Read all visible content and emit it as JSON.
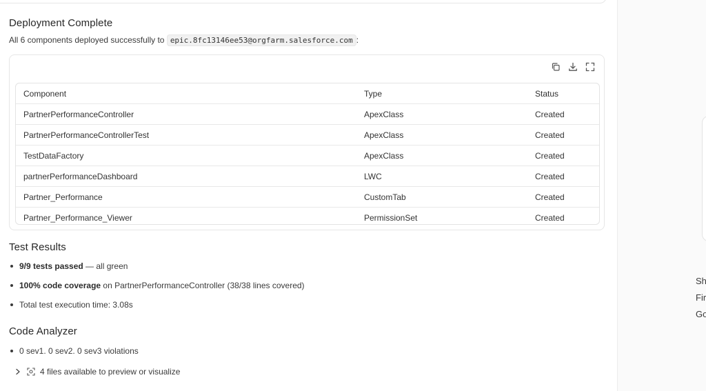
{
  "deployment": {
    "title": "Deployment Complete",
    "summary_prefix": "All 6 components deployed successfully to",
    "org": "epic.8fc13146ee53@orgfarm.salesforce.com",
    "summary_suffix": ":",
    "tools": [
      "copy-icon",
      "download-icon",
      "expand-icon"
    ],
    "table": {
      "headers": [
        "Component",
        "Type",
        "Status"
      ],
      "rows": [
        [
          "PartnerPerformanceController",
          "ApexClass",
          "Created"
        ],
        [
          "PartnerPerformanceControllerTest",
          "ApexClass",
          "Created"
        ],
        [
          "TestDataFactory",
          "ApexClass",
          "Created"
        ],
        [
          "partnerPerformanceDashboard",
          "LWC",
          "Created"
        ],
        [
          "Partner_Performance",
          "CustomTab",
          "Created"
        ],
        [
          "Partner_Performance_Viewer",
          "PermissionSet",
          "Created"
        ]
      ]
    }
  },
  "tests": {
    "title": "Test Results",
    "item1_bold": "9/9 tests passed",
    "item1_rest": " — all green",
    "item2_bold": "100% code coverage",
    "item2_rest": " on PartnerPerformanceController (38/38 lines covered)",
    "item3": "Total test execution time: 3.08s"
  },
  "analyzer": {
    "title": "Code Analyzer",
    "item1": "0 sev1. 0 sev2. 0 sev3 violations"
  },
  "files": {
    "label": "4 files available to preview or visualize"
  },
  "right_panel": {
    "line1": "Sh",
    "line2": "Fir",
    "line3": "Go"
  }
}
